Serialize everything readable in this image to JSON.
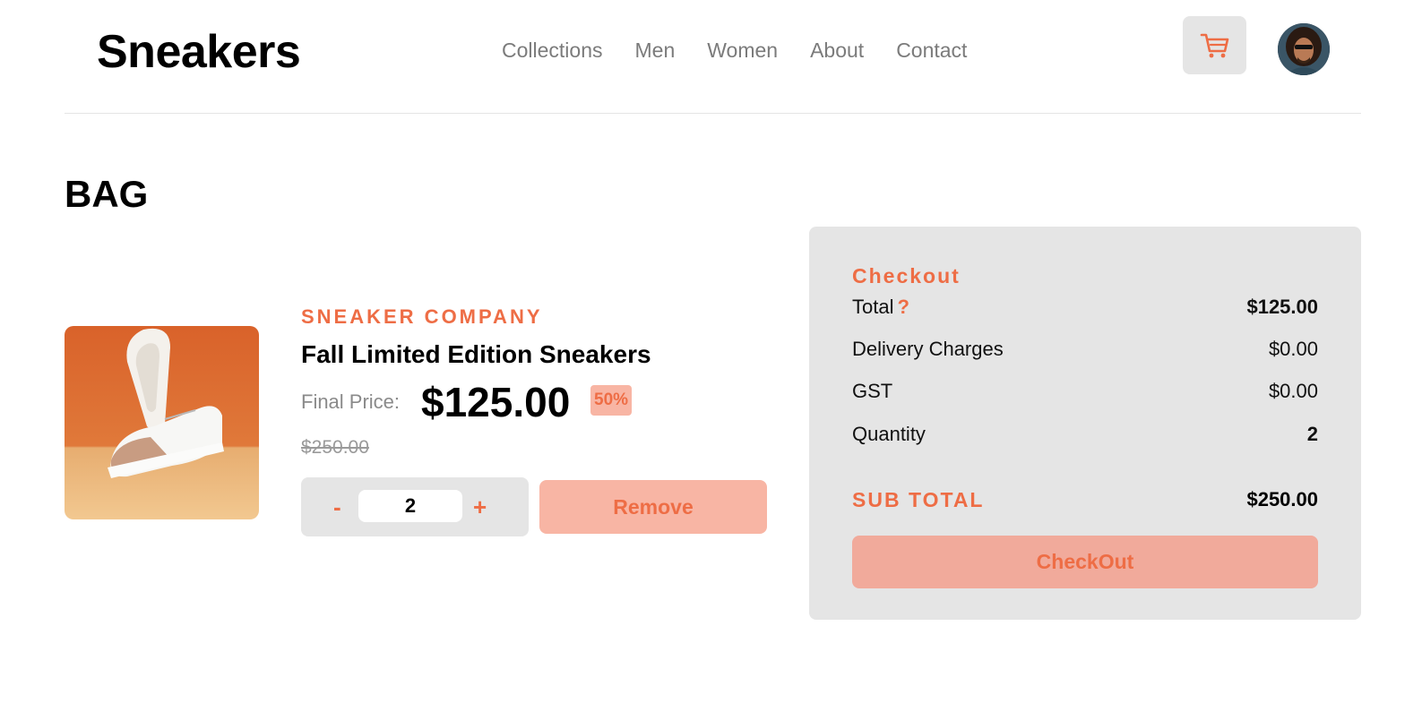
{
  "header": {
    "logo": "Sneakers",
    "nav": [
      "Collections",
      "Men",
      "Women",
      "About",
      "Contact"
    ],
    "cart_icon": "cart-icon",
    "avatar_icon": "user-avatar"
  },
  "page": {
    "title": "BAG"
  },
  "product": {
    "brand": "SNEAKER COMPANY",
    "name": "Fall Limited Edition Sneakers",
    "final_price_label": "Final Price:",
    "final_price": "$125.00",
    "discount": "50%",
    "original_price": "$250.00",
    "quantity": "2",
    "minus_label": "-",
    "plus_label": "+",
    "remove_label": "Remove"
  },
  "checkout": {
    "title": "Checkout",
    "total_label": "Total",
    "total_help": "?",
    "total_value": "$125.00",
    "delivery_label": "Delivery Charges",
    "delivery_value": "$0.00",
    "gst_label": "GST",
    "gst_value": "$0.00",
    "quantity_label": "Quantity",
    "quantity_value": "2",
    "subtotal_label": "SUB TOTAL",
    "subtotal_value": "$250.00",
    "button_label": "CheckOut"
  },
  "colors": {
    "accent": "#ee6d45",
    "accent_light": "#f8b5a4",
    "panel_bg": "#e5e5e5"
  }
}
